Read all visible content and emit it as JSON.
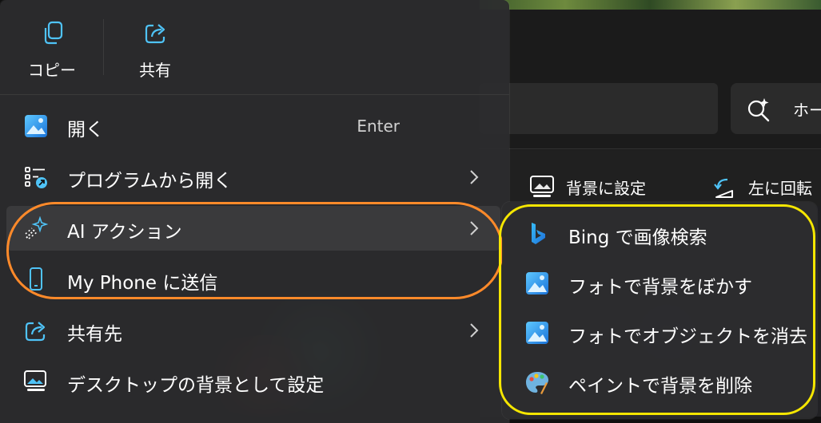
{
  "background_window": {
    "home_button_label": "ホー",
    "toolbar": {
      "set_background_label": "背景に設定",
      "rotate_left_label": "左に回転"
    }
  },
  "context_menu": {
    "quick_actions": [
      {
        "label": "コピー",
        "icon": "copy-icon"
      },
      {
        "label": "共有",
        "icon": "share-icon"
      }
    ],
    "items": [
      {
        "label": "開く",
        "accelerator": "Enter",
        "icon": "photos-app-icon"
      },
      {
        "label": "プログラムから開く",
        "icon": "open-with-icon",
        "submenu": true
      },
      {
        "label": "AI アクション",
        "icon": "ai-sparkle-icon",
        "submenu": true
      },
      {
        "label": "My Phone に送信",
        "icon": "phone-icon"
      },
      {
        "label": "共有先",
        "icon": "share-icon",
        "submenu": true
      },
      {
        "label": "デスクトップの背景として設定",
        "icon": "desktop-background-icon"
      }
    ]
  },
  "ai_actions_submenu": {
    "items": [
      {
        "label": "Bing で画像検索",
        "icon": "bing-icon"
      },
      {
        "label": "フォトで背景をぼかす",
        "icon": "photos-app-icon"
      },
      {
        "label": "フォトでオブジェクトを消去",
        "icon": "photos-app-icon"
      },
      {
        "label": "ペイントで背景を削除",
        "icon": "paint-palette-icon"
      }
    ]
  },
  "annotations": {
    "orange_color": "#ff8a2a",
    "yellow_color": "#f5e600"
  }
}
